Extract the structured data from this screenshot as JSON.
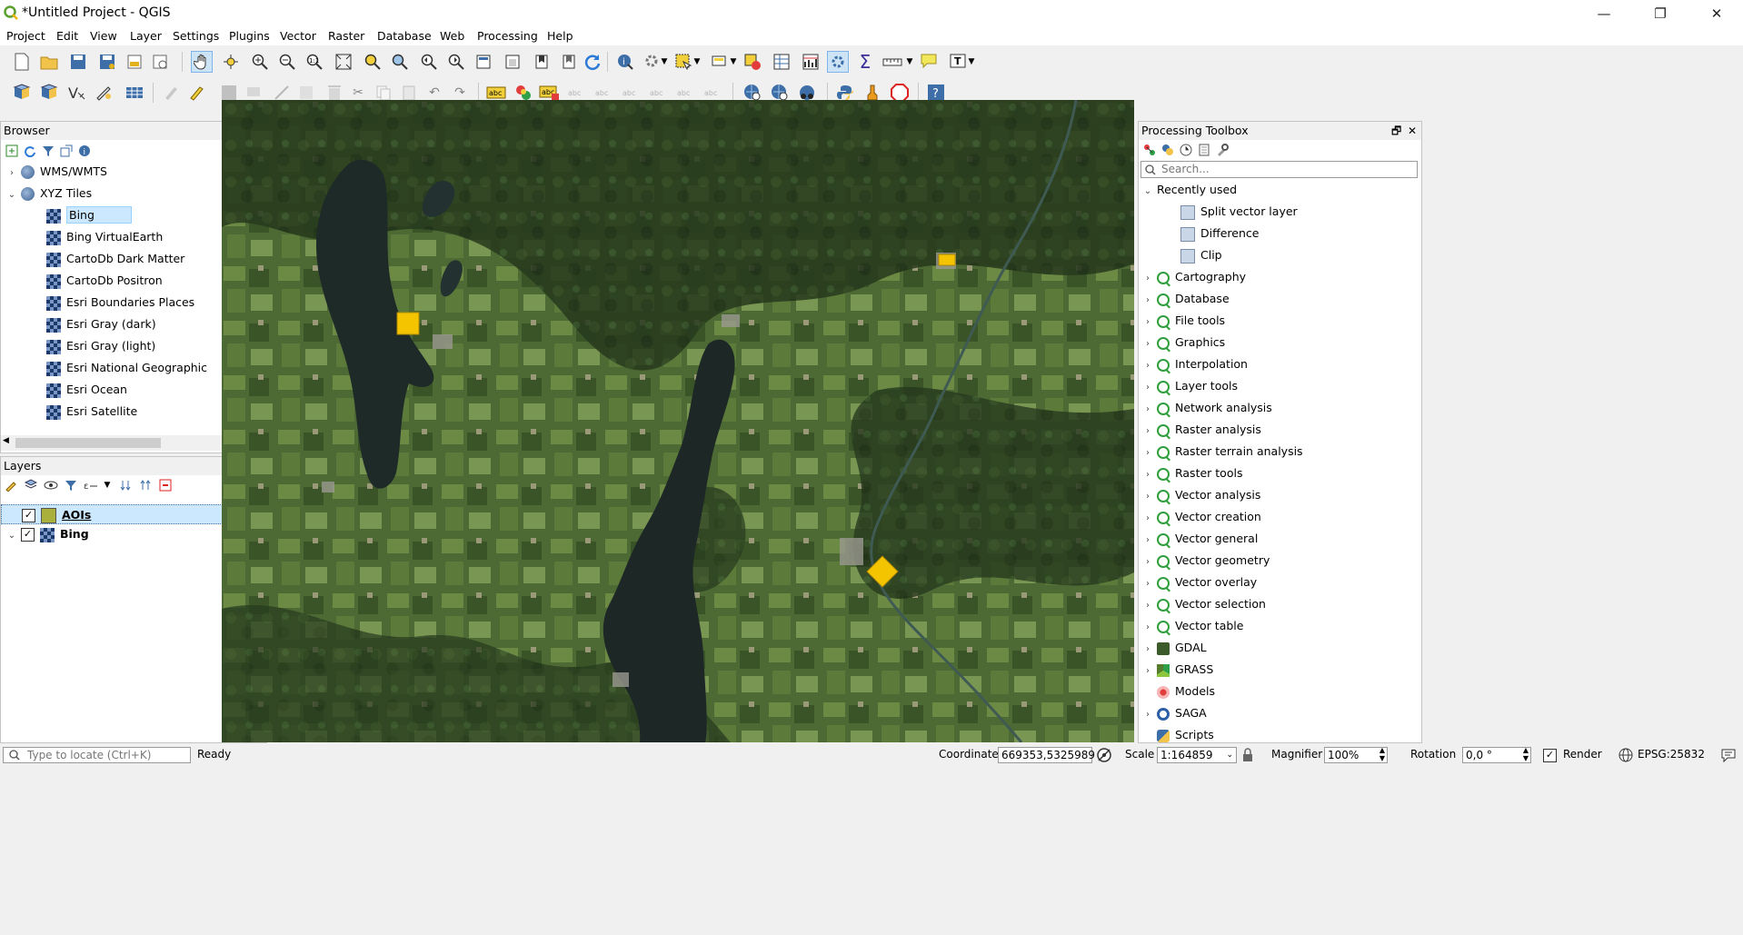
{
  "window": {
    "title": "*Untitled Project - QGIS",
    "controls": [
      "—",
      "❐",
      "✕"
    ]
  },
  "menu": [
    "Project",
    "Edit",
    "View",
    "Layer",
    "Settings",
    "Plugins",
    "Vector",
    "Raster",
    "Database",
    "Web",
    "Processing",
    "Help"
  ],
  "browser": {
    "title": "Browser",
    "items": [
      {
        "label": "WMS/WMTS",
        "icon": "globe-icon",
        "expanded": false
      },
      {
        "label": "XYZ Tiles",
        "icon": "globe-icon",
        "expanded": true
      },
      {
        "label": "Bing",
        "icon": "tile-icon",
        "selected": true
      },
      {
        "label": "Bing VirtualEarth",
        "icon": "tile-icon"
      },
      {
        "label": "CartoDb Dark Matter",
        "icon": "tile-icon"
      },
      {
        "label": "CartoDb Positron",
        "icon": "tile-icon"
      },
      {
        "label": "Esri Boundaries Places",
        "icon": "tile-icon"
      },
      {
        "label": "Esri Gray (dark)",
        "icon": "tile-icon"
      },
      {
        "label": "Esri Gray (light)",
        "icon": "tile-icon"
      },
      {
        "label": "Esri National Geographic",
        "icon": "tile-icon"
      },
      {
        "label": "Esri Ocean",
        "icon": "tile-icon"
      },
      {
        "label": "Esri Satellite",
        "icon": "tile-icon"
      }
    ]
  },
  "layers": {
    "title": "Layers",
    "items": [
      {
        "label": "AOIs",
        "checked": true,
        "swatch": "#a9b13c",
        "selected": true
      },
      {
        "label": "Bing",
        "checked": true,
        "swatch": "tile"
      }
    ]
  },
  "toolbox": {
    "title": "Processing Toolbox",
    "search_placeholder": "Search...",
    "recently_used_label": "Recently used",
    "recent": [
      "Split vector layer",
      "Difference",
      "Clip"
    ],
    "groups": [
      "Cartography",
      "Database",
      "File tools",
      "Graphics",
      "Interpolation",
      "Layer tools",
      "Network analysis",
      "Raster analysis",
      "Raster terrain analysis",
      "Raster tools",
      "Vector analysis",
      "Vector creation",
      "Vector general",
      "Vector geometry",
      "Vector overlay",
      "Vector selection",
      "Vector table"
    ],
    "providers": [
      {
        "label": "GDAL",
        "icon": "gdal-icon"
      },
      {
        "label": "GRASS",
        "icon": "grass-icon"
      },
      {
        "label": "Models",
        "icon": "models-icon"
      },
      {
        "label": "SAGA",
        "icon": "saga-icon"
      },
      {
        "label": "Scripts",
        "icon": "python-icon"
      }
    ]
  },
  "map": {
    "aoi_color": "#f5c400"
  },
  "status": {
    "locator_placeholder": "Type to locate (Ctrl+K)",
    "ready": "Ready",
    "coordinate_label": "Coordinate",
    "coordinate_value": "669353,5325989",
    "scale_label": "Scale",
    "scale_value": "1:164859",
    "magnifier_label": "Magnifier",
    "magnifier_value": "100%",
    "rotation_label": "Rotation",
    "rotation_value": "0,0 °",
    "render_label": "Render",
    "crs": "EPSG:25832"
  }
}
